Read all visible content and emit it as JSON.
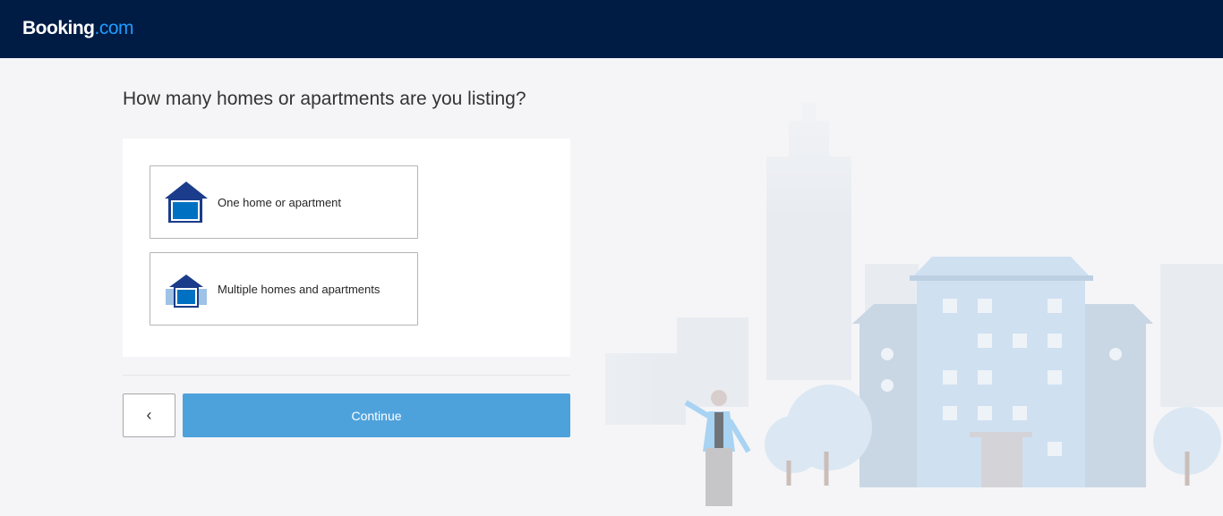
{
  "header": {
    "brand_main": "Booking",
    "brand_tld": ".com"
  },
  "main": {
    "question": "How many homes or apartments are you listing?",
    "options": [
      {
        "label": "One home or apartment",
        "icon": "single-house-icon"
      },
      {
        "label": "Multiple homes and apartments",
        "icon": "multiple-houses-icon"
      }
    ],
    "back_icon": "chevron-left-icon",
    "back_glyph": "‹",
    "continue_label": "Continue"
  },
  "colors": {
    "header_bg": "#001b44",
    "brand_accent": "#1f9dff",
    "button_primary": "#4ea2dc",
    "house_dark": "#1a3c8a",
    "house_blue": "#0071c2"
  }
}
